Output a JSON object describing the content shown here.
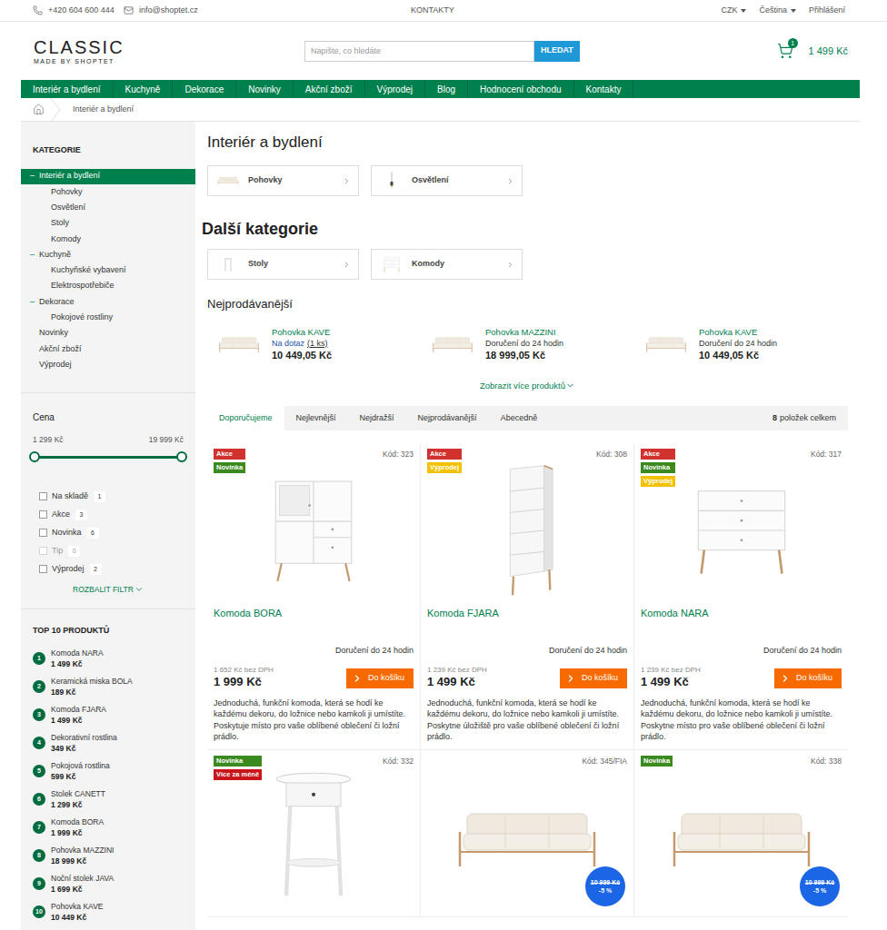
{
  "top_bar": {
    "phone": "+420 604 600 444",
    "email": "info@shoptet.cz",
    "link": "KONTAKTY",
    "currency": "CZK",
    "language": "Čeština",
    "login": "Přihlášení"
  },
  "header": {
    "logo_title": "CLASSIC",
    "logo_subtitle": "MADE BY SHOPTET",
    "search_placeholder": "Napište, co hledáte",
    "search_button": "HLEDAT",
    "cart_count": "1",
    "cart_total": "1 499 Kč"
  },
  "nav": [
    "Interiér a bydlení",
    "Kuchyně",
    "Dekorace",
    "Novinky",
    "Akční zboží",
    "Výprodej",
    "Blog",
    "Hodnocení obchodu",
    "Kontakty"
  ],
  "breadcrumb": [
    "Interiér a bydlení"
  ],
  "sidebar": {
    "categories_title": "KATEGORIE",
    "categories": [
      {
        "label": "Interiér a bydlení",
        "level": 0,
        "toggle": "–",
        "selected": true
      },
      {
        "label": "Pohovky",
        "level": 1,
        "toggle": "",
        "selected": false
      },
      {
        "label": "Osvětlení",
        "level": 1,
        "toggle": "",
        "selected": false
      },
      {
        "label": "Stoly",
        "level": 1,
        "toggle": "",
        "selected": false
      },
      {
        "label": "Komody",
        "level": 1,
        "toggle": "",
        "selected": false
      },
      {
        "label": "Kuchyně",
        "level": 0,
        "toggle": "–",
        "selected": false
      },
      {
        "label": "Kuchyňské vybavení",
        "level": 1,
        "toggle": "",
        "selected": false
      },
      {
        "label": "Elektrospotřebiče",
        "level": 1,
        "toggle": "",
        "selected": false
      },
      {
        "label": "Dekorace",
        "level": 0,
        "toggle": "–",
        "selected": false
      },
      {
        "label": "Pokojové rostliny",
        "level": 1,
        "toggle": "",
        "selected": false
      },
      {
        "label": "Novinky",
        "level": 0,
        "toggle": "",
        "selected": false
      },
      {
        "label": "Akční zboží",
        "level": 0,
        "toggle": "",
        "selected": false
      },
      {
        "label": "Výprodej",
        "level": 0,
        "toggle": "",
        "selected": false
      }
    ],
    "price": {
      "title": "Cena",
      "min": "1 299 Kč",
      "max": "19 999 Kč",
      "level_from": 0,
      "level_to": 1
    },
    "filters": [
      {
        "label": "Na skladě",
        "count": "1",
        "checked": false,
        "disabled": false
      },
      {
        "label": "Akce",
        "count": "3",
        "checked": false,
        "disabled": false
      },
      {
        "label": "Novinka",
        "count": "6",
        "checked": false,
        "disabled": false
      },
      {
        "label": "Tip",
        "count": "0",
        "checked": false,
        "disabled": true
      },
      {
        "label": "Výprodej",
        "count": "2",
        "checked": false,
        "disabled": false
      }
    ],
    "expand_filter": "ROZBALIT FILTR",
    "top_title": "TOP 10 PRODUKTŮ",
    "top": [
      {
        "rank": "1",
        "name": "Komoda NARA",
        "price": "1 499 Kč"
      },
      {
        "rank": "2",
        "name": "Keramická miska BOLA",
        "price": "189 Kč"
      },
      {
        "rank": "3",
        "name": "Komoda FJARA",
        "price": "1 499 Kč"
      },
      {
        "rank": "4",
        "name": "Dekorativní rostlina",
        "price": "349 Kč"
      },
      {
        "rank": "5",
        "name": "Pokojová rostlina",
        "price": "599 Kč"
      },
      {
        "rank": "6",
        "name": "Stolek CANETT",
        "price": "1 299 Kč"
      },
      {
        "rank": "7",
        "name": "Komoda BORA",
        "price": "1 999 Kč"
      },
      {
        "rank": "8",
        "name": "Pohovka MAZZINI",
        "price": "18 999 Kč"
      },
      {
        "rank": "9",
        "name": "Noční stolek JAVA",
        "price": "1 699 Kč"
      },
      {
        "rank": "10",
        "name": "Pohovka KAVE",
        "price": "10 449 Kč"
      }
    ]
  },
  "main": {
    "title": "Interiér a bydlení",
    "subcategories": [
      {
        "label": "Pohovky",
        "kind": "sofa"
      },
      {
        "label": "Osvětlení",
        "kind": "lamp"
      }
    ],
    "other_title": "Další kategorie",
    "other_categories": [
      {
        "label": "Stoly",
        "kind": "table"
      },
      {
        "label": "Komody",
        "kind": "dresser"
      }
    ],
    "bestsellers_title": "Nejprodávanější",
    "bestsellers": [
      {
        "name": "Pohovka KAVE",
        "availability": "Na dotaz",
        "availability_note": "(1 ks)",
        "kind": "inquiry",
        "price": "10 449,05 Kč"
      },
      {
        "name": "Pohovka MAZZINI",
        "availability": "Doručení do 24 hodin",
        "availability_note": "",
        "kind": "delivery",
        "price": "18 999,05 Kč"
      },
      {
        "name": "Pohovka KAVE",
        "availability": "Doručení do 24 hodin",
        "availability_note": "",
        "kind": "delivery",
        "price": "10 449,05 Kč"
      }
    ],
    "show_more": "Zobrazit více produktů",
    "sort_tabs": [
      {
        "label": "Doporučujeme",
        "selected": true
      },
      {
        "label": "Nejlevnější",
        "selected": false
      },
      {
        "label": "Nejdražší",
        "selected": false
      },
      {
        "label": "Nejprodávanější",
        "selected": false
      },
      {
        "label": "Abecedně",
        "selected": false
      }
    ],
    "count": "8",
    "count_label": "položek celkem",
    "products": [
      {
        "kind": "cabinet",
        "flags": [
          {
            "label": "Akce",
            "color": "#d2322d"
          },
          {
            "label": "Novinka",
            "color": "#3b8a1f"
          }
        ],
        "code": "Kód: 323",
        "name": "Komoda BORA",
        "availability": "Doručení do 24 hodin",
        "price_excl": "1 652 Kč bez DPH",
        "price": "1 999 Kč",
        "button": "Do košíku",
        "description": "Jednoduchá, funkční komoda, která se hodí ke každému dekoru, do ložnice nebo kamkoli ji umístíte. Poskytuje místo pro vaše oblíbené oblečení či ložní prádlo.",
        "discount": null
      },
      {
        "kind": "tall-dresser",
        "flags": [
          {
            "label": "Akce",
            "color": "#d2322d"
          },
          {
            "label": "Výprodej",
            "color": "#f2c200"
          }
        ],
        "code": "Kód: 308",
        "name": "Komoda FJARA",
        "availability": "Doručení do 24 hodin",
        "price_excl": "1 239 Kč bez DPH",
        "price": "1 499 Kč",
        "button": "Do košíku",
        "description": "Jednoduchá, funkční komoda, která se hodí ke každému dekoru, do ložnice nebo kamkoli ji umístíte. Poskytne úložiště pro vaše oblíbené oblečení či ložní prádlo.",
        "discount": null
      },
      {
        "kind": "dresser",
        "flags": [
          {
            "label": "Akce",
            "color": "#d2322d"
          },
          {
            "label": "Novinka",
            "color": "#3b8a1f"
          },
          {
            "label": "Výprodej",
            "color": "#f2c200"
          }
        ],
        "code": "Kód: 317",
        "name": "Komoda NARA",
        "availability": "Doručení do 24 hodin",
        "price_excl": "1 239 Kč bez DPH",
        "price": "1 499 Kč",
        "button": "Do košíku",
        "description": "Jednoduchá, funkční komoda, která se hodí ke každému dekoru, do ložnice nebo kamkoli ji umístíte. Poskytne místo pro vaše oblíbené oblečení či ložní prádlo.",
        "discount": null
      },
      {
        "kind": "nightstand",
        "flags": [
          {
            "label": "Novinka",
            "color": "#3b8a1f"
          },
          {
            "label": "Více za méně",
            "color": "#c8151b"
          }
        ],
        "code": "Kód: 332",
        "name": "",
        "availability": "",
        "price_excl": "",
        "price": "",
        "button": "",
        "description": "",
        "discount": null
      },
      {
        "kind": "sofa",
        "flags": [],
        "code": "Kód: 345/FIA",
        "name": "",
        "availability": "",
        "price_excl": "",
        "price": "",
        "button": "",
        "description": "",
        "discount": {
          "old_price": "10 999 Kč",
          "percent": "-5 %"
        }
      },
      {
        "kind": "sofa",
        "flags": [
          {
            "label": "Novinka",
            "color": "#3b8a1f"
          }
        ],
        "code": "Kód: 338",
        "name": "",
        "availability": "",
        "price_excl": "",
        "price": "",
        "button": "",
        "description": "",
        "discount": {
          "old_price": "10 999 Kč",
          "percent": "-5 %"
        }
      }
    ]
  }
}
